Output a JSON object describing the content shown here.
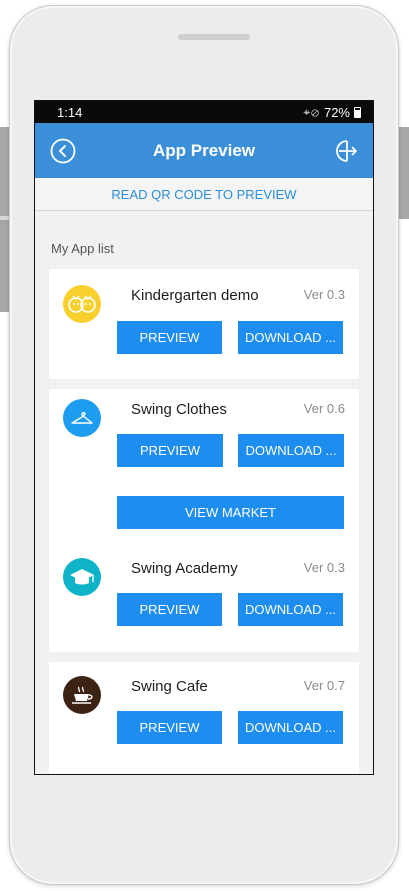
{
  "status_bar": {
    "time": "1:14",
    "battery": "72%"
  },
  "header": {
    "title": "App Preview",
    "back_icon": "circle-back-icon",
    "exit_icon": "exit-icon"
  },
  "qr_link": "READ QR CODE TO PREVIEW",
  "section_title": "My App list",
  "apps": [
    {
      "name": "Kindergarten demo",
      "version": "Ver 0.3",
      "preview_label": "PREVIEW",
      "download_label": "DOWNLOAD ...",
      "logo_color": "#f7d02e",
      "icon": "kids-faces-icon"
    },
    {
      "name": "Swing Clothes",
      "version": "Ver 0.6",
      "preview_label": "PREVIEW",
      "download_label": "DOWNLOAD ...",
      "market_label": "VIEW MARKET",
      "logo_color": "#1d9cf0",
      "icon": "hanger-icon"
    },
    {
      "name": "Swing Academy",
      "version": "Ver 0.3",
      "preview_label": "PREVIEW",
      "download_label": "DOWNLOAD ...",
      "logo_color": "#0fb3c7",
      "icon": "graduation-cap-icon"
    },
    {
      "name": "Swing Cafe",
      "version": "Ver 0.7",
      "preview_label": "PREVIEW",
      "download_label": "DOWNLOAD ...",
      "logo_color": "#3d2314",
      "icon": "coffee-cup-icon"
    }
  ],
  "colors": {
    "appbar": "#3a8fd8",
    "button": "#1e8df0",
    "link": "#2a8fd9"
  }
}
